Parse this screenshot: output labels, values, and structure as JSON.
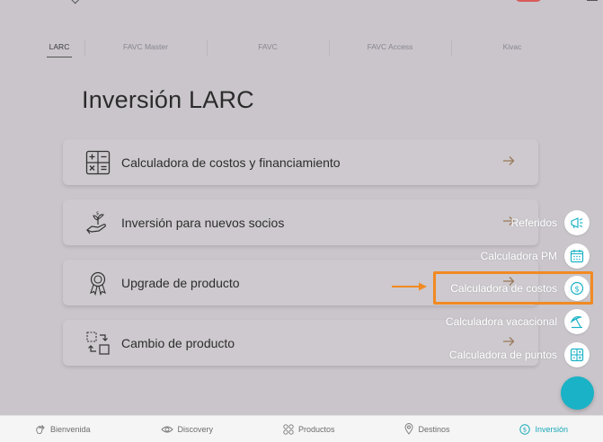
{
  "tabs": [
    {
      "label": "LARC",
      "active": true
    },
    {
      "label": "FAVC Master",
      "active": false
    },
    {
      "label": "FAVC",
      "active": false
    },
    {
      "label": "FAVC Access",
      "active": false
    },
    {
      "label": "Kivac",
      "active": false
    }
  ],
  "page": {
    "title": "Inversión LARC"
  },
  "cards": [
    {
      "label": "Calculadora de costos y financiamiento",
      "icon": "calculator-icon"
    },
    {
      "label": "Inversión para nuevos socios",
      "icon": "hand-money-plant-icon"
    },
    {
      "label": "Upgrade de producto",
      "icon": "award-ribbon-icon"
    },
    {
      "label": "Cambio de producto",
      "icon": "swap-arrows-icon"
    }
  ],
  "fab_menu": [
    {
      "label": "Referidos",
      "icon": "megaphone-icon"
    },
    {
      "label": "Calculadora PM",
      "icon": "calendar-icon"
    },
    {
      "label": "Calculadora de costos",
      "icon": "dollar-coin-icon",
      "highlighted": true
    },
    {
      "label": "Calculadora vacacional",
      "icon": "beach-umbrella-icon"
    },
    {
      "label": "Calculadora de puntos",
      "icon": "grid-points-icon"
    }
  ],
  "bottom_nav": [
    {
      "label": "Bienvenida",
      "icon": "waving-hand-icon"
    },
    {
      "label": "Discovery",
      "icon": "eye-icon"
    },
    {
      "label": "Productos",
      "icon": "grid-circles-icon"
    },
    {
      "label": "Destinos",
      "icon": "location-pin-icon"
    },
    {
      "label": "Inversión",
      "icon": "dollar-circle-icon",
      "active": true
    }
  ],
  "colors": {
    "accent": "#1ab2c6",
    "highlight": "#f18a22",
    "arrow": "#9a7a5a",
    "overlay_bg": "#c9c5cb"
  }
}
